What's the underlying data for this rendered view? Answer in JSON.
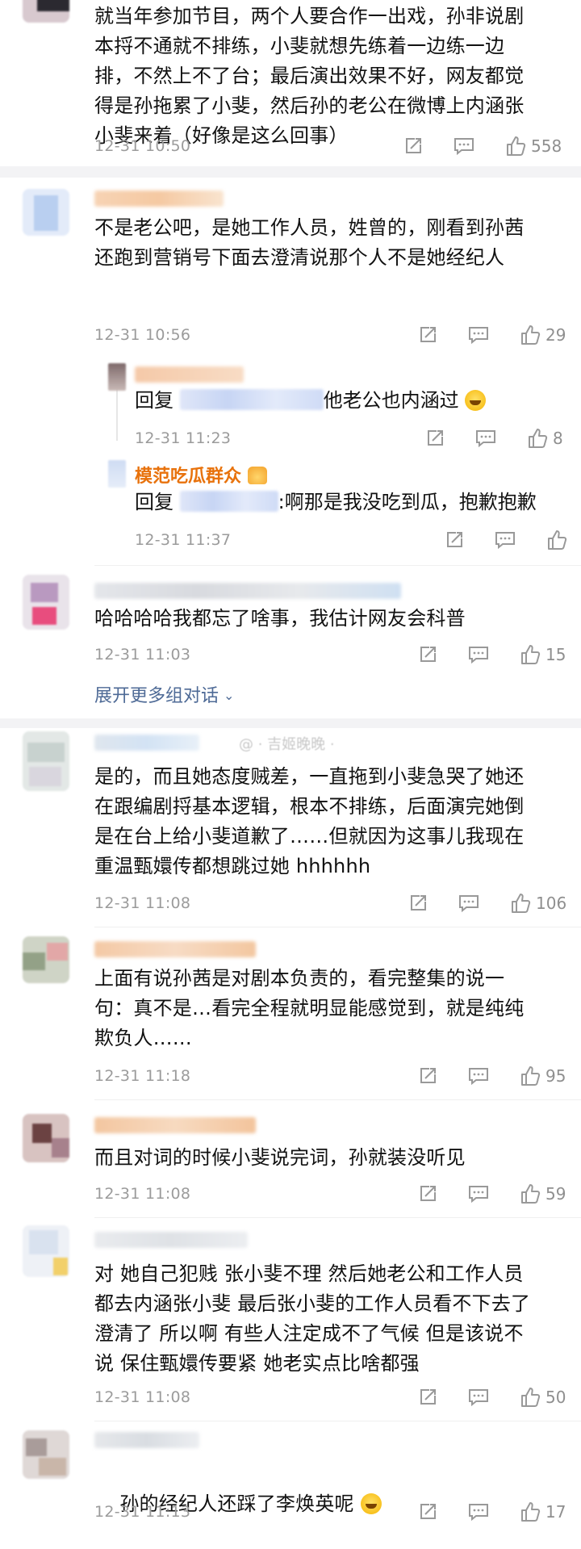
{
  "comments": [
    {
      "id": "c1",
      "text": "就当年参加节目，两个人要合作一出戏，孙非说剧\n本捋不通就不排练，小斐就想先练着一边练一边\n排，不然上不了台；最后演出效果不好，网友都觉\n得是孙拖累了小斐，然后孙的老公在微博上内涵张\n小斐来着（好像是这么回事）",
      "time": "12-31 10:50",
      "likes": "558"
    },
    {
      "id": "c2",
      "text": "不是老公吧，是她工作人员，姓曾的，刚看到孙茜\n还跑到营销号下面去澄清说那个人不是她经纪人",
      "time": "12-31 10:56",
      "likes": "29"
    },
    {
      "id": "c3",
      "text": "哈哈哈哈我都忘了啥事，我估计网友会科普",
      "time": "12-31 11:03",
      "likes": "15"
    },
    {
      "id": "c4",
      "text": "是的，而且她态度贼差，一直拖到小斐急哭了她还\n在跟编剧捋基本逻辑，根本不排练，后面演完她倒\n是在台上给小斐道歉了……但就因为这事儿我现在\n重温甄嬛传都想跳过她 hhhhhh",
      "time": "12-31 11:08",
      "likes": "106"
    },
    {
      "id": "c5",
      "text": "上面有说孙茜是对剧本负责的，看完整集的说一\n句：真不是…看完全程就明显能感觉到，就是纯纯\n欺负人……",
      "time": "12-31 11:18",
      "likes": "95"
    },
    {
      "id": "c6",
      "text": "而且对词的时候小斐说完词，孙就装没听见",
      "time": "12-31 11:08",
      "likes": "59"
    },
    {
      "id": "c7",
      "text": "对 她自己犯贱 张小斐不理 然后她老公和工作人员\n都去内涵张小斐 最后张小斐的工作人员看不下去了\n澄清了 所以啊 有些人注定成不了气候 但是该说不\n说 保住甄嬛传要紧 她老实点比啥都强",
      "time": "12-31 11:08",
      "likes": "50"
    },
    {
      "id": "c8",
      "text": "孙的经纪人还踩了李焕英呢",
      "time": "12-31 11:13",
      "likes": "17"
    }
  ],
  "replies": [
    {
      "id": "r1",
      "prefix": "回复",
      "suffix": "他老公也内涵过",
      "time": "12-31 11:23",
      "likes": "8"
    },
    {
      "id": "r2",
      "name": "模范吃瓜群众",
      "prefix": "回复",
      "suffix": ":啊那是我没吃到瓜，抱歉抱歉",
      "time": "12-31 11:37",
      "likes": ""
    }
  ],
  "expand_label": "展开更多组对话",
  "watermark": "@ · 吉姬晚晚 ·",
  "colors": {
    "link": "#4e6a96",
    "vip": "#e8720c",
    "meta": "#9b9b9b",
    "divider": "#f3f3f5"
  },
  "icons": [
    "share-icon",
    "comment-icon",
    "like-icon",
    "laugh-emoji-icon",
    "chevron-down-icon",
    "vip-crown-icon"
  ]
}
